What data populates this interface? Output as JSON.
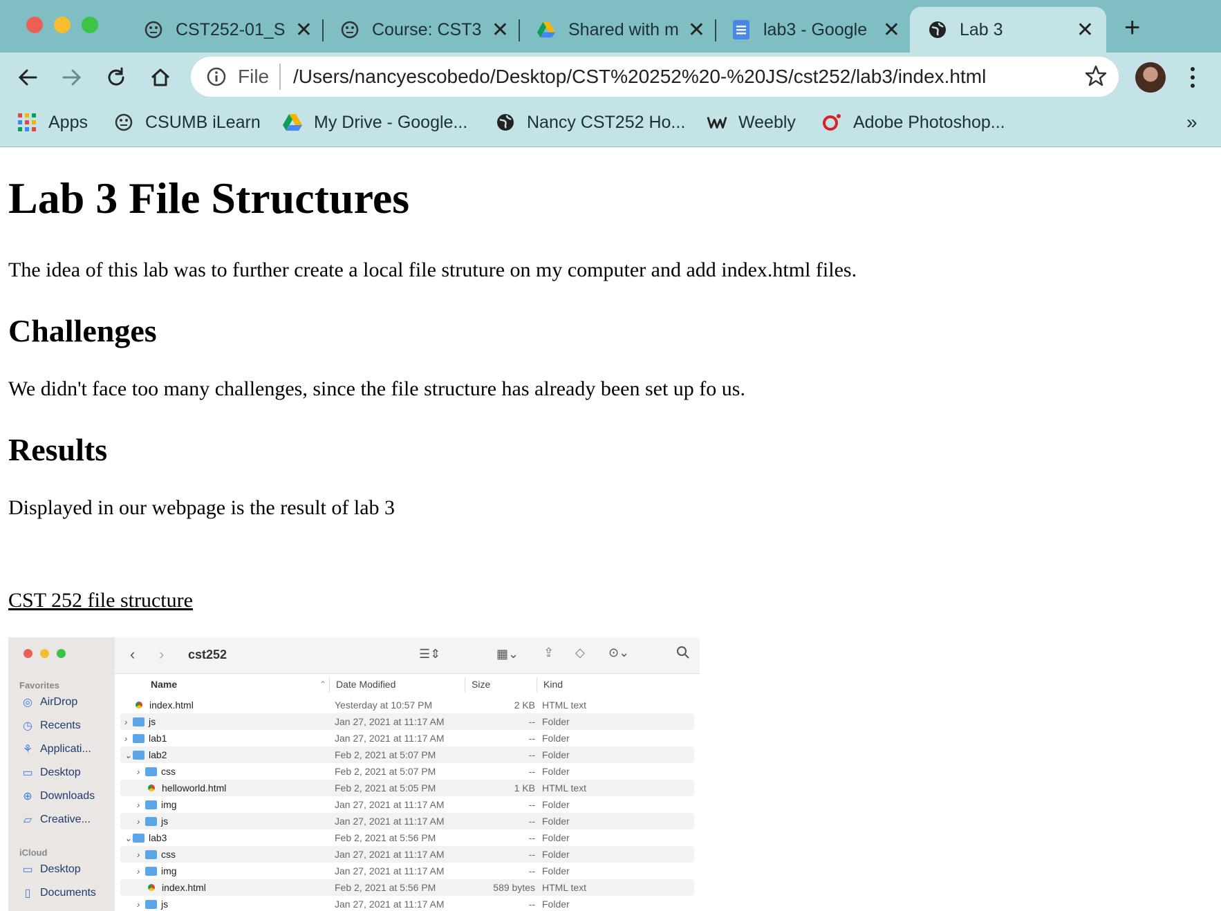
{
  "browser": {
    "tabs": [
      {
        "label": "CST252-01_S",
        "icon": "ilearn-icon"
      },
      {
        "label": "Course: CST3",
        "icon": "ilearn-icon"
      },
      {
        "label": "Shared with m",
        "icon": "google-drive-icon"
      },
      {
        "label": "lab3 - Google",
        "icon": "google-docs-icon"
      },
      {
        "label": "Lab 3",
        "icon": "globe-icon",
        "active": true
      }
    ],
    "omnibox": {
      "scheme_label": "File",
      "url": "/Users/nancyescobedo/Desktop/CST%20252%20-%20JS/cst252/lab3/index.html"
    },
    "bookmarks": [
      {
        "label": "Apps",
        "icon": "apps-grid-icon"
      },
      {
        "label": "CSUMB iLearn",
        "icon": "ilearn-icon"
      },
      {
        "label": "My Drive - Google...",
        "icon": "google-drive-icon"
      },
      {
        "label": "Nancy CST252 Ho...",
        "icon": "globe-icon"
      },
      {
        "label": "Weebly",
        "icon": "weebly-icon"
      },
      {
        "label": "Adobe Photoshop...",
        "icon": "photoshop-icon"
      }
    ],
    "overflow_label": "»"
  },
  "page": {
    "title": "Lab 3 File Structures",
    "intro": "The idea of this lab was to further create a local file struture on my computer and add index.html files.",
    "challenges_heading": "Challenges",
    "challenges_text": "We didn't face too many challenges, since the file structure has already been set up fo us.",
    "results_heading": "Results",
    "results_text": "Displayed in our webpage is the result of lab 3",
    "link_text": "CST 252 file structure"
  },
  "finder": {
    "folder_title": "cst252",
    "sidebar": {
      "favorites_label": "Favorites",
      "favorites": [
        "AirDrop",
        "Recents",
        "Applicati...",
        "Desktop",
        "Downloads",
        "Creative..."
      ],
      "icloud_label": "iCloud",
      "icloud": [
        "Desktop",
        "Documents"
      ]
    },
    "columns": {
      "name": "Name",
      "date": "Date Modified",
      "size": "Size",
      "kind": "Kind"
    },
    "rows": [
      {
        "name": "index.html",
        "date": "Yesterday at 10:57 PM",
        "size": "2 KB",
        "kind": "HTML text"
      },
      {
        "name": "js",
        "date": "Jan 27, 2021 at 11:17 AM",
        "size": "--",
        "kind": "Folder"
      },
      {
        "name": "lab1",
        "date": "Jan 27, 2021 at 11:17 AM",
        "size": "--",
        "kind": "Folder"
      },
      {
        "name": "lab2",
        "date": "Feb 2, 2021 at 5:07 PM",
        "size": "--",
        "kind": "Folder"
      },
      {
        "name": "css",
        "date": "Feb 2, 2021 at 5:07 PM",
        "size": "--",
        "kind": "Folder"
      },
      {
        "name": "helloworld.html",
        "date": "Feb 2, 2021 at 5:05 PM",
        "size": "1 KB",
        "kind": "HTML text"
      },
      {
        "name": "img",
        "date": "Jan 27, 2021 at 11:17 AM",
        "size": "--",
        "kind": "Folder"
      },
      {
        "name": "js",
        "date": "Jan 27, 2021 at 11:17 AM",
        "size": "--",
        "kind": "Folder"
      },
      {
        "name": "lab3",
        "date": "Feb 2, 2021 at 5:56 PM",
        "size": "--",
        "kind": "Folder"
      },
      {
        "name": "css",
        "date": "Jan 27, 2021 at 11:17 AM",
        "size": "--",
        "kind": "Folder"
      },
      {
        "name": "img",
        "date": "Jan 27, 2021 at 11:17 AM",
        "size": "--",
        "kind": "Folder"
      },
      {
        "name": "index.html",
        "date": "Feb 2, 2021 at 5:56 PM",
        "size": "589 bytes",
        "kind": "HTML text"
      },
      {
        "name": "js",
        "date": "Jan 27, 2021 at 11:17 AM",
        "size": "--",
        "kind": "Folder"
      }
    ]
  },
  "colors": {
    "chrome_frame": "#7fbfc4",
    "chrome_toolbar": "#c4e3e6",
    "finder_sidebar": "#e9e6e4",
    "folder_blue": "#5aa6e8"
  }
}
